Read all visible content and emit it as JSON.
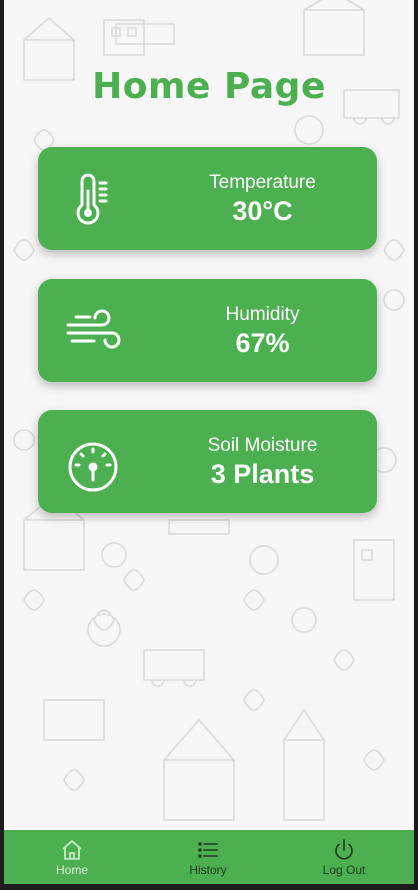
{
  "page": {
    "title": "Home Page"
  },
  "cards": [
    {
      "label": "Temperature",
      "value": "30°C",
      "icon": "thermometer-icon"
    },
    {
      "label": "Humidity",
      "value": "67%",
      "icon": "wind-icon"
    },
    {
      "label": "Soil Moisture",
      "value": "3 Plants",
      "icon": "gauge-icon"
    }
  ],
  "nav": [
    {
      "label": "Home",
      "icon": "home-icon",
      "active": true
    },
    {
      "label": "History",
      "icon": "list-icon",
      "active": false
    },
    {
      "label": "Log Out",
      "icon": "power-icon",
      "active": false
    }
  ],
  "colors": {
    "accent": "#4caf50",
    "nav_active": "#d8efd8",
    "nav_inactive": "#1f3a1f",
    "background": "#f7f7f7"
  }
}
